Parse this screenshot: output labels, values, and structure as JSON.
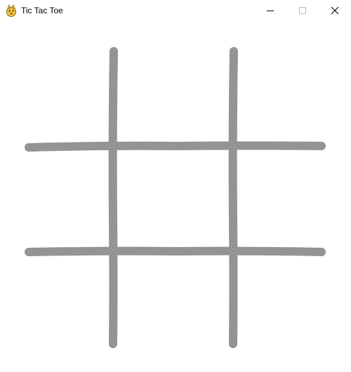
{
  "window": {
    "title": "Tic Tac Toe",
    "app_icon": "python-snake-icon",
    "controls": {
      "minimize_icon": "minimize-icon",
      "maximize_icon": "maximize-icon",
      "close_icon": "close-icon"
    }
  },
  "board": {
    "rows": 3,
    "cols": 3,
    "grid_color": "#8a8a8a",
    "cells": [
      [
        "",
        "",
        ""
      ],
      [
        "",
        "",
        ""
      ],
      [
        "",
        "",
        ""
      ]
    ]
  }
}
